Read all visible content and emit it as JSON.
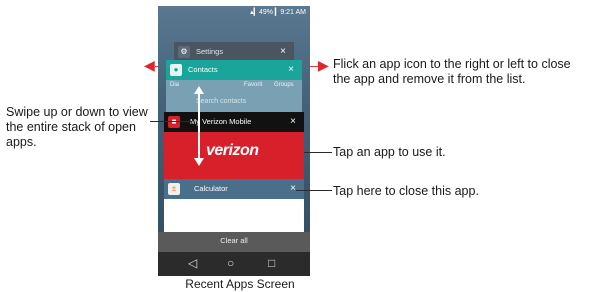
{
  "annotations": {
    "flick": "Flick an app icon to the right or left to close the app and remove it from the list.",
    "swipe": "Swipe up or down to view the entire stack of open apps.",
    "tap_use": "Tap an app to use it.",
    "tap_close": "Tap here to close this app.",
    "caption": "Recent Apps Screen"
  },
  "status_bar": {
    "text": "▴▎49% ▎9:21 AM"
  },
  "cards": {
    "settings": {
      "label": "Settings",
      "close": "×",
      "icon": "gear-icon"
    },
    "contacts": {
      "label": "Contacts",
      "close": "×",
      "icon": "contact-icon",
      "tabs": [
        "Dia",
        "Favorit",
        "Groups"
      ],
      "search_placeholder": "Search contacts"
    },
    "verizon": {
      "label": "My Verizon Mobile",
      "close": "×",
      "logo": "verizon",
      "icon": "verizon-icon"
    },
    "calculator": {
      "label": "Calculator",
      "close": "×",
      "icon": "calculator-icon"
    }
  },
  "clear_all": "Clear all",
  "navbar": {
    "back": "◁",
    "home": "○",
    "recents": "□"
  },
  "colors": {
    "contacts_header": "#1aa59a",
    "verizon_header": "#111111",
    "verizon_body": "#d8202a",
    "arrow_red": "#e0262b"
  }
}
